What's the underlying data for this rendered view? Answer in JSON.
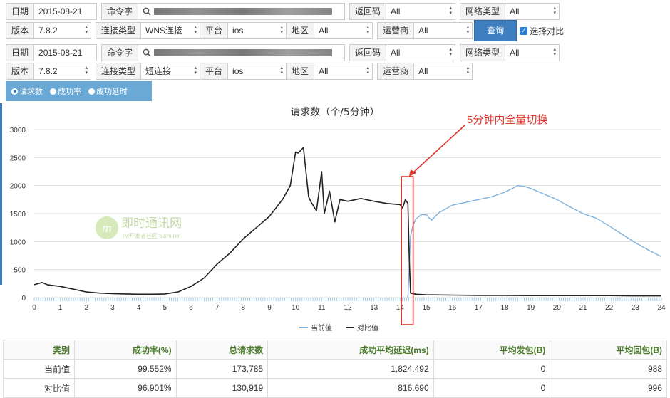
{
  "filter_rows": [
    {
      "date_label": "日期",
      "date_value": "2015-08-21",
      "command_label": "命令字",
      "return_code_label": "返回码",
      "return_code_value": "All",
      "network_type_label": "网络类型",
      "network_type_value": "All"
    },
    {
      "version_label": "版本",
      "version_value": "7.8.2",
      "conn_type_label": "连接类型",
      "conn_type_value": "WNS连接",
      "platform_label": "平台",
      "platform_value": "ios",
      "region_label": "地区",
      "region_value": "All",
      "carrier_label": "运营商",
      "carrier_value": "All"
    },
    {
      "date_label": "日期",
      "date_value": "2015-08-21",
      "command_label": "命令字",
      "return_code_label": "返回码",
      "return_code_value": "All",
      "network_type_label": "网络类型",
      "network_type_value": "All"
    },
    {
      "version_label": "版本",
      "version_value": "7.8.2",
      "conn_type_label": "连接类型",
      "conn_type_value": "短连接",
      "platform_label": "平台",
      "platform_value": "ios",
      "region_label": "地区",
      "region_value": "All",
      "carrier_label": "运营商",
      "carrier_value": "All"
    }
  ],
  "query_button": "查询",
  "compare_checkbox": "选择对比",
  "metric_tabs": [
    "请求数",
    "成功率",
    "成功延时"
  ],
  "watermark": {
    "brand": "即时通讯网",
    "sub": "IM开发者社区 52im.net"
  },
  "annotation": "5分钟内全量切换",
  "colors": {
    "current": "#7fb2dc",
    "compare": "#222222",
    "annotation": "#e0342a",
    "accent": "#3f7fbf"
  },
  "chart_data": {
    "type": "line",
    "title": "请求数（个/5分钟）",
    "x_ticks": [
      "0",
      "1",
      "2",
      "3",
      "4",
      "5",
      "6",
      "7",
      "8",
      "9",
      "10",
      "11",
      "12",
      "13",
      "14",
      "15",
      "16",
      "17",
      "18",
      "19",
      "20",
      "21",
      "22",
      "23",
      "24"
    ],
    "y_ticks": [
      "0",
      "500",
      "1000",
      "1500",
      "2000",
      "2500",
      "3000"
    ],
    "xlim": [
      0,
      24
    ],
    "ylim": [
      0,
      3000
    ],
    "grid": true,
    "legend_position": "bottom",
    "series": [
      {
        "name": "当前值",
        "x": [
          14.3,
          14.4,
          14.5,
          14.6,
          14.8,
          15,
          15.2,
          15.5,
          16,
          16.5,
          17,
          17.5,
          18,
          18.3,
          18.5,
          18.8,
          19,
          19.5,
          20,
          20.5,
          21,
          21.5,
          22,
          22.5,
          23,
          23.5,
          24
        ],
        "values": [
          0,
          1100,
          1300,
          1400,
          1480,
          1480,
          1380,
          1520,
          1650,
          1700,
          1750,
          1800,
          1880,
          1950,
          2000,
          1980,
          1950,
          1850,
          1750,
          1620,
          1500,
          1420,
          1280,
          1130,
          980,
          850,
          730
        ]
      },
      {
        "name": "对比值",
        "x": [
          0,
          0.3,
          0.5,
          1,
          1.5,
          2,
          2.5,
          3,
          3.5,
          4,
          4.5,
          5,
          5.5,
          6,
          6.5,
          7,
          7.5,
          8,
          8.5,
          9,
          9.5,
          9.8,
          10,
          10.1,
          10.3,
          10.5,
          10.6,
          10.8,
          11,
          11.1,
          11.3,
          11.5,
          11.7,
          12,
          12.5,
          13,
          13.5,
          14,
          14.1,
          14.2,
          14.3,
          14.35,
          14.4,
          14.6,
          15,
          16,
          17,
          18,
          19,
          20,
          21,
          22,
          23,
          24
        ],
        "values": [
          230,
          270,
          230,
          200,
          150,
          100,
          80,
          70,
          65,
          60,
          60,
          65,
          100,
          200,
          350,
          600,
          800,
          1050,
          1250,
          1450,
          1750,
          2000,
          2600,
          2580,
          2680,
          1800,
          1700,
          1550,
          2250,
          1500,
          1900,
          1350,
          1750,
          1720,
          1770,
          1720,
          1680,
          1660,
          1600,
          1750,
          1680,
          700,
          80,
          60,
          50,
          45,
          40,
          40,
          35,
          35,
          35,
          35,
          30,
          30
        ]
      }
    ]
  },
  "table": {
    "headers": [
      "类别",
      "成功率(%)",
      "总请求数",
      "成功平均延迟(ms)",
      "平均发包(B)",
      "平均回包(B)"
    ],
    "rows": [
      [
        "当前值",
        "99.552%",
        "173,785",
        "1,824.492",
        "0",
        "988"
      ],
      [
        "对比值",
        "96.901%",
        "130,919",
        "816.690",
        "0",
        "996"
      ]
    ]
  }
}
